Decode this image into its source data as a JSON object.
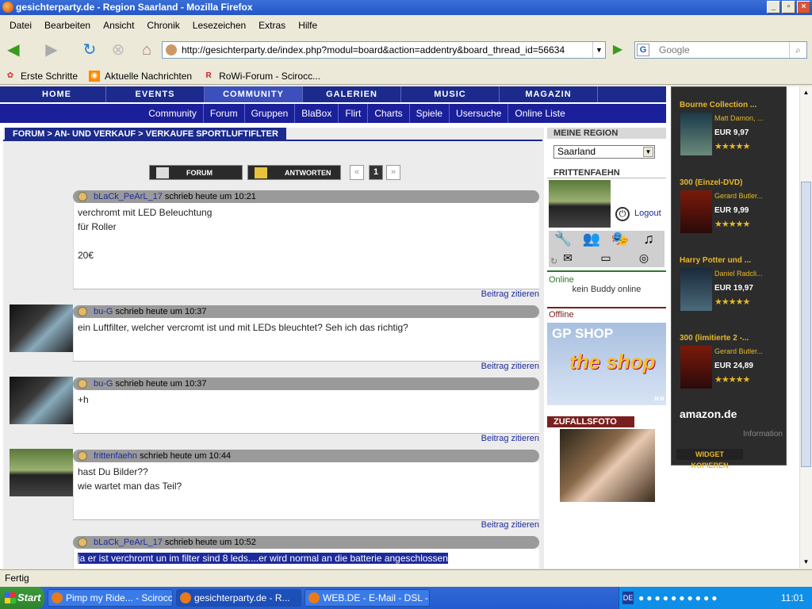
{
  "window": {
    "title": "gesichterparty.de - Region Saarland - Mozilla Firefox"
  },
  "menu": [
    "Datei",
    "Bearbeiten",
    "Ansicht",
    "Chronik",
    "Lesezeichen",
    "Extras",
    "Hilfe"
  ],
  "url": "http://gesichterparty.de/index.php?modul=board&action=addentry&board_thread_id=56634",
  "search_placeholder": "Google",
  "bookmarks": [
    "Erste Schritte",
    "Aktuelle Nachrichten",
    "RoWi-Forum - Scirocc..."
  ],
  "topnav": [
    "HOME",
    "EVENTS",
    "COMMUNITY",
    "GALERIEN",
    "MUSIC",
    "MAGAZIN"
  ],
  "subnav": [
    "Community",
    "Forum",
    "Gruppen",
    "BlaBox",
    "Flirt",
    "Charts",
    "Spiele",
    "Usersuche",
    "Online Liste"
  ],
  "breadcrumb": "FORUM > AN- UND VERKAUF > VERKAUFE SPORTLUFTIFLTER",
  "buttons": {
    "forum": "FORUM",
    "answer": "ANTWORTEN"
  },
  "pager": {
    "prev": "«",
    "current": "1",
    "next": "»"
  },
  "posts": [
    {
      "user": "bLaCk_PeArL_17",
      "meta": "schrieb heute um 10:21",
      "lines": [
        "verchromt mit LED Beleuchtung",
        "für Roller",
        "",
        "20€"
      ],
      "quote": "Beitrag zitieren"
    },
    {
      "user": "bu-G",
      "meta": "schrieb heute um 10:37",
      "lines": [
        "ein Luftfilter, welcher vercromt ist und mit LEDs bleuchtet? Seh ich das richtig?"
      ],
      "quote": "Beitrag zitieren"
    },
    {
      "user": "bu-G",
      "meta": "schrieb heute um 10:37",
      "lines": [
        "+h"
      ],
      "quote": "Beitrag zitieren"
    },
    {
      "user": "frittenfaehn",
      "meta": "schrieb heute um 10:44",
      "lines": [
        "hast Du Bilder??",
        "wie wartet man das Teil?"
      ],
      "quote": "Beitrag zitieren"
    },
    {
      "user": "bLaCk_PeArL_17",
      "meta": "schrieb heute um 10:52",
      "lines": [
        "ja er ist verchromt un im filter sind 8 leds....er wird normal an die batterie angeschlossen"
      ],
      "quote": ""
    }
  ],
  "sidebar": {
    "region_title": "MEINE REGION",
    "region_value": "Saarland",
    "user_title": "FRITTENFAEHN",
    "logout": "Logout",
    "online": "Online",
    "no_buddy": "kein Buddy online",
    "offline": "Offline",
    "shop_title": "GP SHOP",
    "shop_logo": "the shop",
    "photo_title": "ZUFALLSFOTO"
  },
  "amazon": {
    "products": [
      {
        "title": "Bourne Collection ...",
        "actor": "Matt Damon, ...",
        "price": "EUR 9,97",
        "stars": "★★★★★"
      },
      {
        "title": "300 (Einzel-DVD)",
        "actor": "Gerard Butler...",
        "price": "EUR 9,99",
        "stars": "★★★★★"
      },
      {
        "title": "Harry Potter und ...",
        "actor": "Daniel Radcli...",
        "price": "EUR 19,97",
        "stars": "★★★★★"
      },
      {
        "title": "300 (limitierte 2 -...",
        "actor": "Gerard Butler...",
        "price": "EUR 24,89",
        "stars": "★★★★★"
      }
    ],
    "logo": "amazon.de",
    "info": "Information",
    "widget": "WIDGET KOPIEREN"
  },
  "status": "Fertig",
  "taskbar": {
    "start": "Start",
    "tasks": [
      "Pimp my Ride... - Scirocc...",
      "gesichterparty.de - R...",
      "WEB.DE - E-Mail - DSL - ..."
    ],
    "clock": "11:01",
    "lang": "DE"
  }
}
